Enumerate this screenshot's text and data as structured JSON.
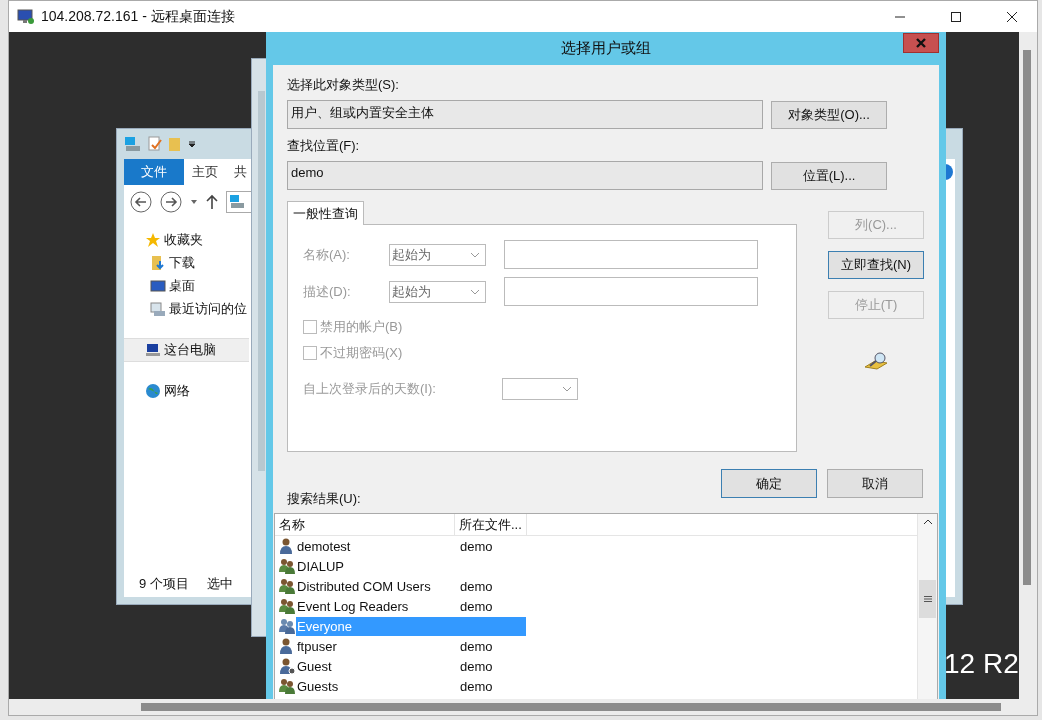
{
  "rdp": {
    "title": "104.208.72.161 - 远程桌面连接"
  },
  "explorer": {
    "ribbon_tabs": [
      {
        "label": "文件",
        "selected": true
      },
      {
        "label": "主页",
        "selected": false
      },
      {
        "label": "共",
        "selected": false
      }
    ],
    "nav": [
      {
        "label": "收藏夹",
        "kind": "favorites",
        "selected": false,
        "children": [
          {
            "label": "下载",
            "kind": "download",
            "selected": false
          },
          {
            "label": "桌面",
            "kind": "desktop",
            "selected": false
          },
          {
            "label": "最近访问的位",
            "kind": "recent",
            "selected": false
          }
        ]
      },
      {
        "label": "这台电脑",
        "kind": "computer",
        "selected": true
      },
      {
        "label": "网络",
        "kind": "network",
        "selected": false
      }
    ],
    "status": [
      "9 个项目",
      "选中"
    ]
  },
  "desktop_text": "12 R2",
  "dialog": {
    "title": "选择用户或组",
    "fields": [
      {
        "label": "选择此对象类型(S):",
        "value": "用户、组或内置安全主体",
        "button": "对象类型(O)..."
      },
      {
        "label": "查找位置(F):",
        "value": "demo",
        "button": "位置(L)..."
      }
    ],
    "query_tab": "一般性查询",
    "filters": [
      {
        "label": "名称(A):",
        "mode": "起始为"
      },
      {
        "label": "描述(D):",
        "mode": "起始为"
      }
    ],
    "checks": [
      {
        "label": "禁用的帐户(B)",
        "checked": false
      },
      {
        "label": "不过期密码(X)",
        "checked": false
      }
    ],
    "days_label": "自上次登录后的天数(I):",
    "side_buttons": [
      {
        "label": "列(C)...",
        "disabled": true,
        "focused": false
      },
      {
        "label": "立即查找(N)",
        "disabled": false,
        "focused": true
      },
      {
        "label": "停止(T)",
        "disabled": true,
        "focused": false
      }
    ],
    "ok": "确定",
    "cancel": "取消",
    "results_label": "搜索结果(U):",
    "columns": [
      "名称",
      "所在文件..."
    ],
    "rows": [
      {
        "name": "demotest",
        "folder": "demo",
        "kind": "user",
        "selected": false
      },
      {
        "name": "DIALUP",
        "folder": "",
        "kind": "group",
        "selected": false
      },
      {
        "name": "Distributed COM Users",
        "folder": "demo",
        "kind": "group",
        "selected": false
      },
      {
        "name": "Event Log Readers",
        "folder": "demo",
        "kind": "group",
        "selected": false
      },
      {
        "name": "Everyone",
        "folder": "",
        "kind": "wellknown",
        "selected": true
      },
      {
        "name": "ftpuser",
        "folder": "demo",
        "kind": "user",
        "selected": false
      },
      {
        "name": "Guest",
        "folder": "demo",
        "kind": "guest",
        "selected": false
      },
      {
        "name": "Guests",
        "folder": "demo",
        "kind": "group",
        "selected": false
      }
    ]
  }
}
